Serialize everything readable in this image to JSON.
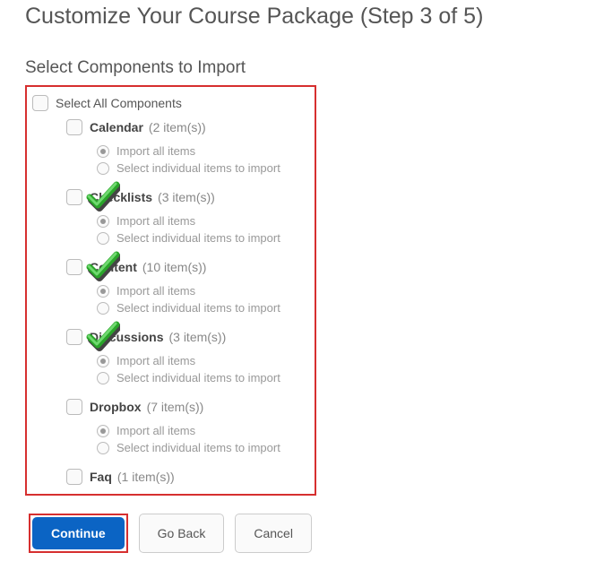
{
  "page_title": "Customize Your Course Package (Step 3 of 5)",
  "section_title": "Select Components to Import",
  "select_all_label": "Select All Components",
  "radio_options": {
    "import_all": "Import all items",
    "select_individual": "Select individual items to import"
  },
  "components": [
    {
      "name": "Calendar",
      "count_label": "(2 item(s))",
      "checked": false
    },
    {
      "name": "Checklists",
      "count_label": "(3 item(s))",
      "checked": true
    },
    {
      "name": "Content",
      "count_label": "(10 item(s))",
      "checked": true
    },
    {
      "name": "Discussions",
      "count_label": "(3 item(s))",
      "checked": true
    },
    {
      "name": "Dropbox",
      "count_label": "(7 item(s))",
      "checked": false
    },
    {
      "name": "Faq",
      "count_label": "(1 item(s))",
      "checked": false
    }
  ],
  "buttons": {
    "continue": "Continue",
    "go_back": "Go Back",
    "cancel": "Cancel"
  },
  "colors": {
    "highlight": "#d62f2f",
    "primary": "#0b64c4",
    "check": "#2aa52a"
  }
}
